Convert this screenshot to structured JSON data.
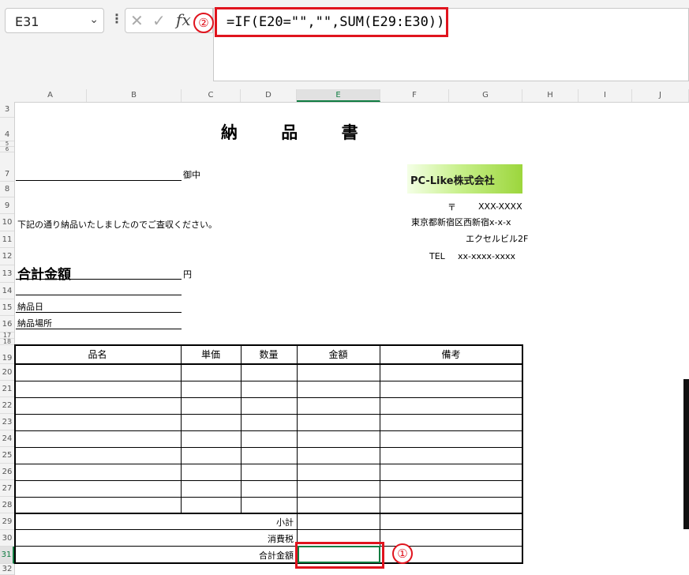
{
  "formula_bar": {
    "name_box": "E31",
    "fx": "fx",
    "formula": "=IF(E20=\"\",\"\",SUM(E29:E30))"
  },
  "markers": {
    "m1": "①",
    "m2": "②"
  },
  "columns": [
    "A",
    "B",
    "C",
    "D",
    "E",
    "F",
    "G",
    "H",
    "I",
    "J"
  ],
  "selected_column": "E",
  "rows": [
    "3",
    "4",
    "5",
    "6",
    "7",
    "8",
    "9",
    "10",
    "11",
    "12",
    "13",
    "14",
    "15",
    "16",
    "17",
    "18",
    "19",
    "20",
    "21",
    "22",
    "23",
    "24",
    "25",
    "26",
    "27",
    "28",
    "29",
    "30",
    "31",
    "32"
  ],
  "selected_row": "31",
  "sheet": {
    "title": "納 品 書",
    "honorific": "御中",
    "intro": "下記の通り納品いたしましたのでご査収ください。",
    "total_label": "合計金額",
    "yen": "円",
    "delivery_date": "納品日",
    "delivery_place": "納品場所",
    "company_logo": "PC-Like株式会社",
    "postal_mark": "〒",
    "postal_code": "XXX-XXXX",
    "address1": "東京都新宿区西新宿x-x-x",
    "address2": "エクセルビル2F",
    "tel_label": "TEL",
    "tel": "xx-xxxx-xxxx"
  },
  "table": {
    "headers": [
      "品名",
      "単価",
      "数量",
      "金額",
      "備考"
    ],
    "subtotal": "小計",
    "tax": "消費税",
    "grand_total": "合計金額"
  }
}
